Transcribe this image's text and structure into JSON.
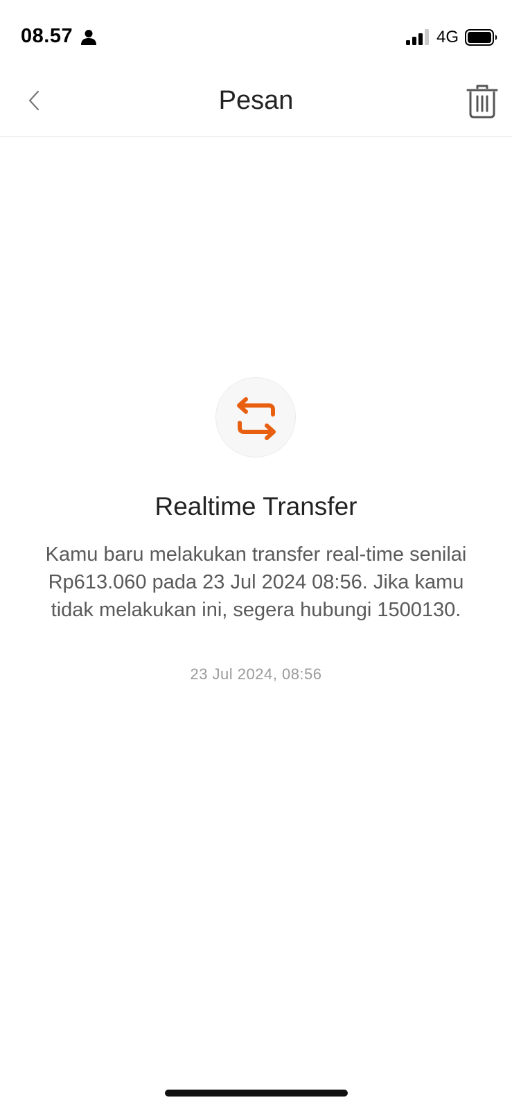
{
  "status_bar": {
    "time": "08.57",
    "network": "4G",
    "icons": [
      "person-icon",
      "signal-icon",
      "battery-icon"
    ]
  },
  "header": {
    "title": "Pesan",
    "back_icon": "chevron-left-icon",
    "delete_icon": "trash-icon"
  },
  "message": {
    "icon": "transfer-arrows-icon",
    "title": "Realtime Transfer",
    "body": "Kamu baru melakukan transfer real-time senilai Rp613.060 pada 23 Jul 2024 08:56. Jika kamu tidak melakukan ini, segera hubungi 1500130.",
    "date": "23 Jul 2024, 08:56"
  },
  "colors": {
    "accent": "#e8600f",
    "text_primary": "#222222",
    "text_secondary": "#5a5a5a",
    "text_muted": "#9a9a9a"
  }
}
